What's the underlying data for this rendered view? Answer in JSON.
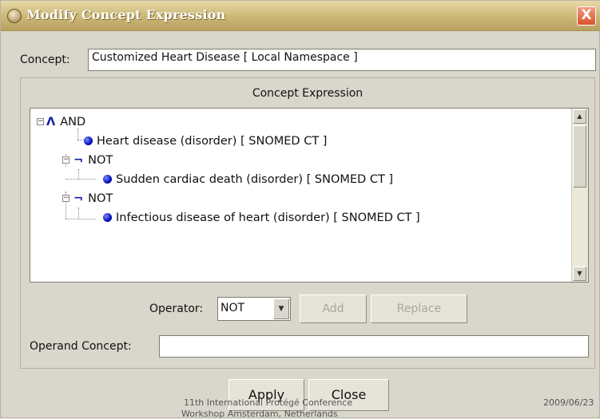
{
  "window": {
    "title": "Modify Concept Expression",
    "close_label": "X"
  },
  "concept": {
    "label": "Concept:",
    "value": "Customized Heart Disease [ Local Namespace ]"
  },
  "expression": {
    "title": "Concept Expression",
    "tree": [
      {
        "symbol": "Λ",
        "text": "AND",
        "expander": "−"
      },
      {
        "text": "Heart disease (disorder) [ SNOMED CT ]"
      },
      {
        "symbol": "¬",
        "text": "NOT",
        "expander": "−"
      },
      {
        "text": "Sudden cardiac death (disorder) [ SNOMED CT ]"
      },
      {
        "symbol": "¬",
        "text": "NOT",
        "expander": "−"
      },
      {
        "text": "Infectious disease of heart (disorder) [ SNOMED CT ]"
      }
    ]
  },
  "operator": {
    "label": "Operator:",
    "value": "NOT",
    "add_label": "Add",
    "replace_label": "Replace"
  },
  "operand": {
    "label": "Operand Concept:",
    "value": ""
  },
  "actions": {
    "apply_label": "Apply",
    "close_label": "Close"
  },
  "footer": {
    "line1": "11th International Protégé Conference",
    "line2": "Workshop Amsterdam, Netherlands",
    "date": "2009/06/23"
  }
}
